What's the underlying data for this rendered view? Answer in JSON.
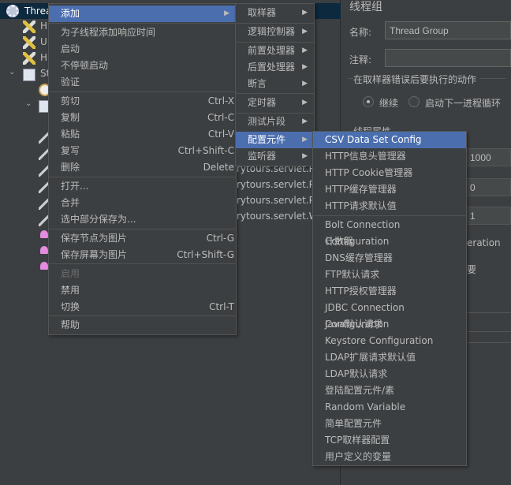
{
  "tree": {
    "selected": "Threa",
    "rows": [
      "H",
      "U",
      "H",
      "St"
    ],
    "clipped": [
      "rytours.servlet.Res",
      "rytours.servlet.Pu",
      "rytours.servlet.Pu",
      "rytours.servlet.We"
    ]
  },
  "panel": {
    "title": "线程组",
    "name_label": "名称:",
    "name_value": "Thread Group",
    "comment_label": "注释:",
    "comment_value": "",
    "error_group": "在取样器错误后要执行的动作",
    "radio_continue": "继续",
    "radio_next_loop": "启动下一进程循环",
    "thread_props": "线程属性",
    "field1": "1000",
    "field2": "0",
    "field3": "1",
    "frag1": "eration",
    "frag2": "要"
  },
  "menu": {
    "items": [
      {
        "label": "添加",
        "arrow": true,
        "highlight": true
      },
      {
        "sep": true
      },
      {
        "label": "为子线程添加响应时间"
      },
      {
        "label": "启动"
      },
      {
        "label": "不停顿启动"
      },
      {
        "label": "验证"
      },
      {
        "sep": true
      },
      {
        "label": "剪切",
        "shortcut": "Ctrl-X"
      },
      {
        "label": "复制",
        "shortcut": "Ctrl-C"
      },
      {
        "label": "粘贴",
        "shortcut": "Ctrl-V"
      },
      {
        "label": "复写",
        "shortcut": "Ctrl+Shift-C"
      },
      {
        "label": "删除",
        "shortcut": "Delete"
      },
      {
        "sep": true
      },
      {
        "label": "打开..."
      },
      {
        "label": "合并"
      },
      {
        "label": "选中部分保存为..."
      },
      {
        "sep": true
      },
      {
        "label": "保存节点为图片",
        "shortcut": "Ctrl-G"
      },
      {
        "label": "保存屏幕为图片",
        "shortcut": "Ctrl+Shift-G"
      },
      {
        "sep": true
      },
      {
        "label": "启用",
        "disabled": true
      },
      {
        "label": "禁用"
      },
      {
        "label": "切换",
        "shortcut": "Ctrl-T"
      },
      {
        "sep": true
      },
      {
        "label": "帮助"
      }
    ]
  },
  "submenu_add": {
    "items": [
      {
        "label": "取样器",
        "arrow": true
      },
      {
        "sep": true
      },
      {
        "label": "逻辑控制器",
        "arrow": true
      },
      {
        "sep": true
      },
      {
        "label": "前置处理器",
        "arrow": true
      },
      {
        "label": "后置处理器",
        "arrow": true
      },
      {
        "label": "断言",
        "arrow": true
      },
      {
        "sep": true
      },
      {
        "label": "定时器",
        "arrow": true
      },
      {
        "sep": true
      },
      {
        "label": "测试片段",
        "arrow": true
      },
      {
        "sep": true
      },
      {
        "label": "配置元件",
        "arrow": true,
        "highlight": true
      },
      {
        "label": "监听器",
        "arrow": true
      }
    ]
  },
  "submenu_config": {
    "items": [
      {
        "label": "CSV Data Set Config",
        "highlight": true
      },
      {
        "label": "HTTP信息头管理器"
      },
      {
        "label": "HTTP Cookie管理器"
      },
      {
        "label": "HTTP缓存管理器"
      },
      {
        "label": "HTTP请求默认值"
      },
      {
        "sep": true
      },
      {
        "label": "Bolt Connection Configuration"
      },
      {
        "label": "计数器"
      },
      {
        "label": "DNS缓存管理器"
      },
      {
        "label": "FTP默认请求"
      },
      {
        "label": "HTTP授权管理器"
      },
      {
        "label": "JDBC Connection Configuration"
      },
      {
        "label": "Java默认请求"
      },
      {
        "label": "Keystore Configuration"
      },
      {
        "label": "LDAP扩展请求默认值"
      },
      {
        "label": "LDAP默认请求"
      },
      {
        "label": "登陆配置元件/素"
      },
      {
        "label": "Random Variable"
      },
      {
        "label": "简单配置元件"
      },
      {
        "label": "TCP取样器配置"
      },
      {
        "label": "用户定义的变量"
      }
    ]
  },
  "colors": {
    "menu_bg": "#3c3f41",
    "highlight": "#4b6eaf",
    "tree_selected": "#0d293e"
  }
}
